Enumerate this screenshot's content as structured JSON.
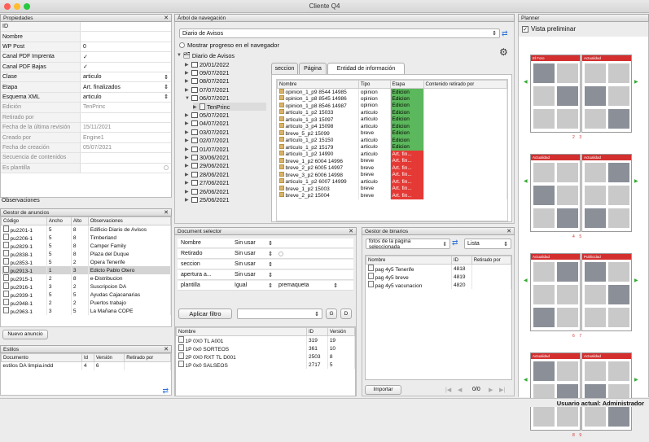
{
  "window": {
    "title": "Cliente Q4"
  },
  "props": {
    "header": "Propiedades",
    "rows": [
      {
        "label": "ID",
        "value": "",
        "dim": false
      },
      {
        "label": "Nombre",
        "value": "",
        "dim": false
      },
      {
        "label": "WP Post",
        "value": "0",
        "dim": false
      },
      {
        "label": "Canal PDF Imprenta",
        "value": "✓",
        "dim": false
      },
      {
        "label": "Canal PDF Bajas",
        "value": "✓",
        "dim": false
      },
      {
        "label": "Clase",
        "value": "articulo",
        "dim": false
      },
      {
        "label": "Etapa",
        "value": "Art. finalizados",
        "dim": false
      },
      {
        "label": "Esquema XML",
        "value": "articulo",
        "dim": false
      },
      {
        "label": "Edición",
        "value": "TenPrinc",
        "dim": true
      },
      {
        "label": "Retirado por",
        "value": "",
        "dim": true
      },
      {
        "label": "Fecha de la última revisión",
        "value": "15/11/2021",
        "dim": true
      },
      {
        "label": "Creado por",
        "value": "Engine1",
        "dim": true
      },
      {
        "label": "Fecha de creación",
        "value": "05/07/2021",
        "dim": true
      },
      {
        "label": "Secuencia de contenidos",
        "value": "",
        "dim": true
      },
      {
        "label": "Es plantilla",
        "value": "",
        "dim": true
      }
    ],
    "observaciones": "Observaciones"
  },
  "anuncios": {
    "header": "Gestor de anuncios",
    "cols": [
      "Código",
      "Ancho",
      "Alto",
      "Observaciones"
    ],
    "rows": [
      [
        "pu2201-1",
        "5",
        "8",
        "Edificio Diario de Avisos"
      ],
      [
        "pu2206-1",
        "5",
        "8",
        "Timberland"
      ],
      [
        "pu2829-1",
        "5",
        "8",
        "Camper Family"
      ],
      [
        "pu2838-1",
        "5",
        "8",
        "Plaza del Duque"
      ],
      [
        "pu2853-1",
        "5",
        "2",
        "Opera Tenerife"
      ],
      [
        "pu2913-1",
        "1",
        "3",
        "Edicto Pablo Otero"
      ],
      [
        "pu2915-1",
        "2",
        "8",
        "e-Distribucion"
      ],
      [
        "pu2916-1",
        "3",
        "2",
        "Suscripcion DA"
      ],
      [
        "pu2939-1",
        "5",
        "5",
        "Ayudas Cajacanarias"
      ],
      [
        "pu2948-1",
        "2",
        "2",
        "Puertos trabajo"
      ],
      [
        "pu2963-1",
        "3",
        "5",
        "La Mañana COPE"
      ]
    ],
    "new_button": "Nuevo anuncio"
  },
  "estilos": {
    "header": "Estilos",
    "cols": [
      "Documento",
      "Id",
      "Versión",
      "Retirado por"
    ],
    "row": [
      "estilos DA limpia.indd",
      "4",
      "6",
      ""
    ]
  },
  "tree": {
    "header": "Árbol de navegación",
    "publication": "Diario de Avisos",
    "progress_label": "Mostrar progreso en el navegador",
    "root": "Diario de Avisos",
    "dates": [
      "20/01/2022",
      "09/07/2021",
      "08/07/2021",
      "07/07/2021",
      "06/07/2021",
      "TenPrinc",
      "05/07/2021",
      "04/07/2021",
      "03/07/2021",
      "02/07/2021",
      "01/07/2021",
      "30/06/2021",
      "29/06/2021",
      "28/06/2021",
      "27/06/2021",
      "26/06/2021",
      "25/06/2021"
    ],
    "tabs": [
      "seccion",
      "Página",
      "Entidad de información"
    ],
    "cols": [
      "Nombre",
      "Tipo",
      "Etapa",
      "Contenido retirado por"
    ],
    "rows": [
      [
        "opinion_1_p9 8544 14985",
        "opinion",
        "Edicion",
        "g"
      ],
      [
        "opinion_1_p8 8545 14986",
        "opinion",
        "Edicion",
        "g"
      ],
      [
        "opinion_1_p8 8546 14987",
        "opinion",
        "Edicion",
        "g"
      ],
      [
        "articulo_1_p2 15033",
        "articulo",
        "Edicion",
        "g"
      ],
      [
        "articulo_1_p3 15097",
        "articulo",
        "Edicion",
        "g"
      ],
      [
        "articulo_3_p4 15098",
        "articulo",
        "Edicion",
        "g"
      ],
      [
        "breve_5_p2 15099",
        "breve",
        "Edicion",
        "g"
      ],
      [
        "articulo_1_p2 15150",
        "articulo",
        "Edicion",
        "g"
      ],
      [
        "articulo_1_p2 15179",
        "articulo",
        "Edicion",
        "g"
      ],
      [
        "articulo_1_p2 14990",
        "articulo",
        "Art. fin...",
        "r"
      ],
      [
        "breve_1_p2 6004 14996",
        "breve",
        "Art. fin...",
        "r"
      ],
      [
        "breve_2_p2 6005 14997",
        "breve",
        "Art. fin...",
        "r"
      ],
      [
        "breve_3_p2 6006 14998",
        "breve",
        "Art. fin...",
        "r"
      ],
      [
        "articulo_1_p2 6007 14999",
        "articulo",
        "Art. fin...",
        "r"
      ],
      [
        "breve_1_p2 15003",
        "breve",
        "Art. fin...",
        "r"
      ],
      [
        "breve_2_p2 15004",
        "breve",
        "Art. fin...",
        "r"
      ]
    ]
  },
  "docsel": {
    "header": "Document selector",
    "rows": [
      {
        "label": "Nombre",
        "value": "Sin usar"
      },
      {
        "label": "Retirado",
        "value": "Sin usar"
      },
      {
        "label": "seccion",
        "value": "Sin usar"
      },
      {
        "label": "apertura a...",
        "value": "Sin usar"
      },
      {
        "label": "plantilla",
        "value": "Igual",
        "extra": "premaqueta"
      }
    ],
    "apply": "Aplicar filtro",
    "g": "G",
    "d": "D",
    "cols": [
      "Nombre",
      "ID",
      "Versión"
    ],
    "rows2": [
      [
        "1P 0X0 TL A001",
        "319",
        "19"
      ],
      [
        "1P 0x0 SORTEOS",
        "361",
        "10"
      ],
      [
        "2P 0X0 RXT TL D001",
        "2503",
        "8"
      ],
      [
        "1P 0x0 SALSEOS",
        "2717",
        "5"
      ]
    ]
  },
  "binarios": {
    "header": "Gestor de binarios",
    "filter": "fotos de la pagina seleccionada",
    "view": "Lista",
    "cols": [
      "Nombre",
      "ID",
      "Retirado por"
    ],
    "rows": [
      [
        "pag 4y5 Tenerife",
        "4818"
      ],
      [
        "pag 4y5 breve",
        "4819"
      ],
      [
        "pag 4y5 vacunacion",
        "4820"
      ]
    ],
    "import": "Importar",
    "pager": "0/0"
  },
  "planner": {
    "header": "Planner",
    "preview": "Vista preliminar",
    "spreads": [
      {
        "left": "El Foro",
        "right": "Actualidad",
        "pages": "2    3"
      },
      {
        "left": "Actualidad",
        "right": "Actualidad",
        "pages": "4    5"
      },
      {
        "left": "Actualidad",
        "right": "Publicidad",
        "pages": "6    7"
      },
      {
        "left": "Actualidad",
        "right": "Actualidad",
        "pages": "8    9"
      }
    ]
  },
  "status": {
    "user": "Usuario actual: Administrador"
  }
}
